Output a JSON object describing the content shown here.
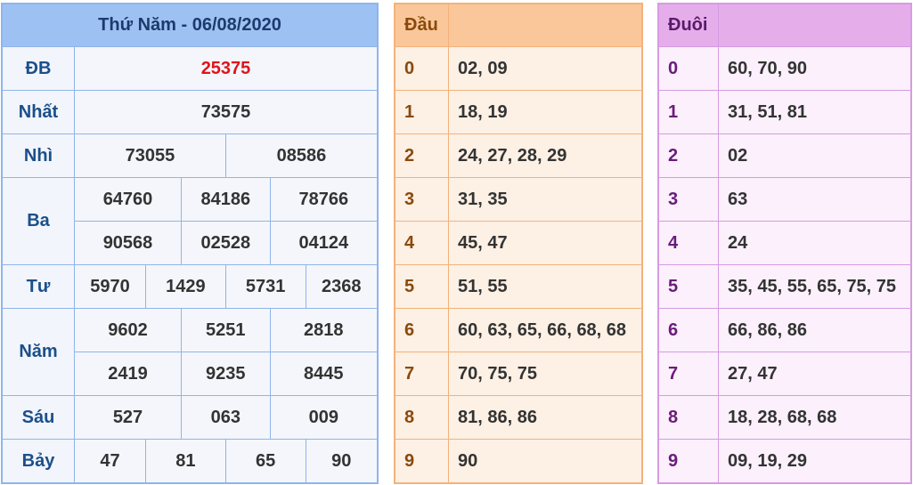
{
  "results": {
    "title": "Thứ Năm - 06/08/2020",
    "db": {
      "label": "ĐB",
      "values": [
        "25375"
      ]
    },
    "nhat": {
      "label": "Nhất",
      "values": [
        "73575"
      ]
    },
    "nhi": {
      "label": "Nhì",
      "values": [
        "73055",
        "08586"
      ]
    },
    "ba": {
      "label": "Ba",
      "values": [
        "64760",
        "84186",
        "78766",
        "90568",
        "02528",
        "04124"
      ]
    },
    "tu": {
      "label": "Tư",
      "values": [
        "5970",
        "1429",
        "5731",
        "2368"
      ]
    },
    "nam": {
      "label": "Năm",
      "values": [
        "9602",
        "5251",
        "2818",
        "2419",
        "9235",
        "8445"
      ]
    },
    "sau": {
      "label": "Sáu",
      "values": [
        "527",
        "063",
        "009"
      ]
    },
    "bay": {
      "label": "Bảy",
      "values": [
        "47",
        "81",
        "65",
        "90"
      ]
    }
  },
  "dau": {
    "header": "Đầu",
    "rows": [
      {
        "k": "0",
        "v": "02, 09"
      },
      {
        "k": "1",
        "v": "18, 19"
      },
      {
        "k": "2",
        "v": "24, 27, 28, 29"
      },
      {
        "k": "3",
        "v": "31, 35"
      },
      {
        "k": "4",
        "v": "45, 47"
      },
      {
        "k": "5",
        "v": "51, 55"
      },
      {
        "k": "6",
        "v": "60, 63, 65, 66, 68, 68"
      },
      {
        "k": "7",
        "v": "70, 75, 75"
      },
      {
        "k": "8",
        "v": "81, 86, 86"
      },
      {
        "k": "9",
        "v": "90"
      }
    ]
  },
  "duoi": {
    "header": "Đuôi",
    "rows": [
      {
        "k": "0",
        "v": "60, 70, 90"
      },
      {
        "k": "1",
        "v": "31, 51, 81"
      },
      {
        "k": "2",
        "v": "02"
      },
      {
        "k": "3",
        "v": "63"
      },
      {
        "k": "4",
        "v": "24"
      },
      {
        "k": "5",
        "v": "35, 45, 55, 65, 75, 75"
      },
      {
        "k": "6",
        "v": "66, 86, 86"
      },
      {
        "k": "7",
        "v": "27, 47"
      },
      {
        "k": "8",
        "v": "18, 28, 68, 68"
      },
      {
        "k": "9",
        "v": "09, 19, 29"
      }
    ]
  }
}
